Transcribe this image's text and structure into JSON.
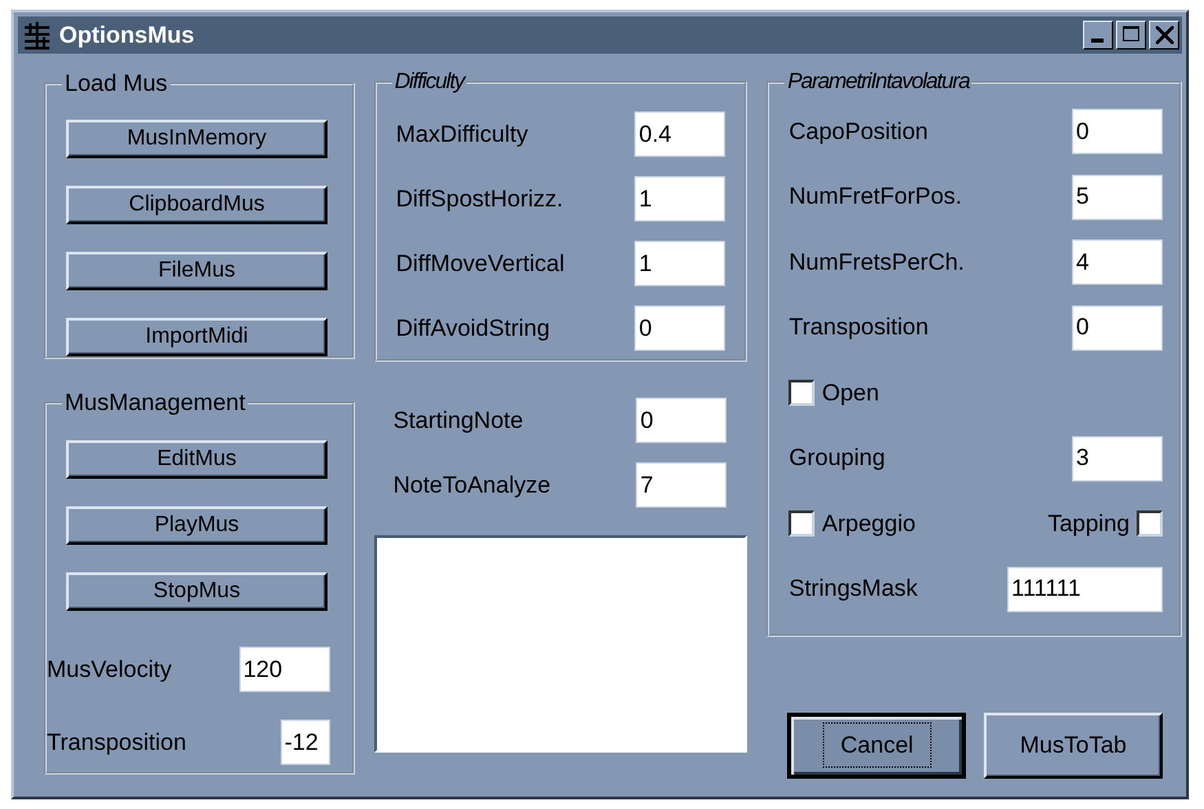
{
  "window": {
    "title": "OptionsMus"
  },
  "load_mus": {
    "title": "Load Mus",
    "buttons": [
      {
        "label": "MusInMemory"
      },
      {
        "label": "ClipboardMus"
      },
      {
        "label": "FileMus"
      },
      {
        "label": "ImportMidi"
      }
    ]
  },
  "mus_management": {
    "title": "MusManagement",
    "buttons": [
      {
        "label": "EditMus"
      },
      {
        "label": "PlayMus"
      },
      {
        "label": "StopMus"
      }
    ],
    "fields": [
      {
        "label": "MusVelocity",
        "value": "120"
      },
      {
        "label": "Transposition",
        "value": "-12"
      }
    ]
  },
  "difficulty": {
    "title": "Difficulty",
    "fields": [
      {
        "label": "MaxDifficulty",
        "value": "0.4"
      },
      {
        "label": "DiffSpostHorizz.",
        "value": "1"
      },
      {
        "label": "DiffMoveVertical",
        "value": "1"
      },
      {
        "label": "DiffAvoidString",
        "value": "0"
      }
    ]
  },
  "notes": {
    "fields": [
      {
        "label": "StartingNote",
        "value": "0"
      },
      {
        "label": "NoteToAnalyze",
        "value": "7"
      }
    ]
  },
  "parametri": {
    "title": "ParametriIntavolatura",
    "items": [
      {
        "kind": "field",
        "label": "CapoPosition",
        "value": "0"
      },
      {
        "kind": "field",
        "label": "NumFretForPos.",
        "value": "5"
      },
      {
        "kind": "field",
        "label": "NumFretsPerCh.",
        "value": "4"
      },
      {
        "kind": "field",
        "label": "Transposition",
        "value": "0"
      },
      {
        "kind": "checkbox",
        "label": "Open",
        "checked": false
      },
      {
        "kind": "field",
        "label": "Grouping",
        "value": "3"
      },
      {
        "kind": "checkpair",
        "left": {
          "label": "Arpeggio",
          "checked": false
        },
        "right": {
          "label": "Tapping",
          "checked": false
        }
      },
      {
        "kind": "widefield",
        "label": "StringsMask",
        "value": "111111"
      }
    ]
  },
  "buttons": [
    {
      "label": "Cancel",
      "focused": true
    },
    {
      "label": "MusToTab",
      "focused": false
    }
  ]
}
